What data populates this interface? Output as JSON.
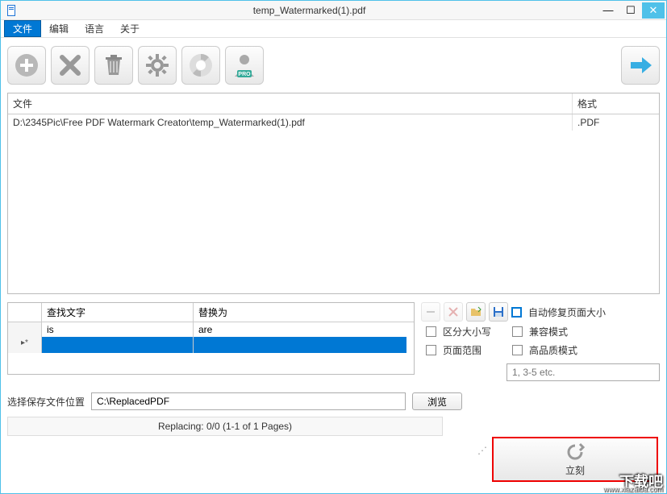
{
  "window": {
    "title": "temp_Watermarked(1).pdf"
  },
  "menu": {
    "file": "文件",
    "edit": "编辑",
    "language": "语言",
    "about": "关于"
  },
  "toolbar_icons": {
    "add": "add-icon",
    "remove": "remove-icon",
    "delete": "delete-icon",
    "settings": "settings-icon",
    "help": "help-icon",
    "pro": "PRO",
    "go": "go-icon"
  },
  "file_table": {
    "header_file": "文件",
    "header_format": "格式",
    "rows": [
      {
        "path": "D:\\2345Pic\\Free PDF Watermark Creator\\temp_Watermarked(1).pdf",
        "format": ".PDF"
      }
    ]
  },
  "replace_table": {
    "header_find": "查找文字",
    "header_replace": "替换为",
    "rows": [
      {
        "find": "is",
        "replace": "are"
      }
    ]
  },
  "options": {
    "auto_fix": "自动修复页面大小",
    "compat": "兼容模式",
    "hq": "高品质模式",
    "case_sensitive": "区分大小写",
    "page_range": "页面范围",
    "page_placeholder": "1, 3-5 etc."
  },
  "save": {
    "label": "选择保存文件位置",
    "path": "C:\\ReplacedPDF",
    "browse": "浏览"
  },
  "action": {
    "label": "立刻"
  },
  "status": {
    "text": "Replacing: 0/0 (1-1 of 1 Pages)"
  },
  "watermark": {
    "main": "下载吧",
    "sub": "www.xiazaiba.com"
  }
}
